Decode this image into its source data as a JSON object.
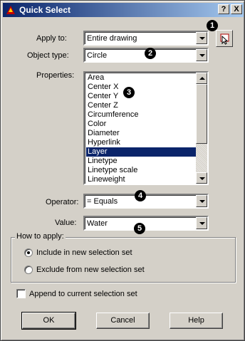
{
  "window": {
    "title": "Quick Select",
    "help_btn": "?",
    "close_btn": "X"
  },
  "form": {
    "apply_to": {
      "label": "Apply to:",
      "value": "Entire drawing"
    },
    "object_type": {
      "label": "Object type:",
      "value": "Circle"
    },
    "properties": {
      "label": "Properties:",
      "items": [
        "Area",
        "Center X",
        "Center Y",
        "Center Z",
        "Circumference",
        "Color",
        "Diameter",
        "Hyperlink",
        "Layer",
        "Linetype",
        "Linetype scale",
        "Lineweight"
      ],
      "selected": "Layer"
    },
    "operator": {
      "label": "Operator:",
      "value": "= Equals"
    },
    "value": {
      "label": "Value:",
      "value": "Water"
    }
  },
  "how_to_apply": {
    "title": "How to apply:",
    "include": "Include in new selection set",
    "exclude": "Exclude from new selection set",
    "selected": "include"
  },
  "append": {
    "label": "Append to current selection set",
    "checked": false
  },
  "buttons": {
    "ok": "OK",
    "cancel": "Cancel",
    "help": "Help"
  },
  "callouts": [
    "1",
    "2",
    "3",
    "4",
    "5"
  ],
  "colors": {
    "title_start": "#0a246a",
    "title_end": "#a6caf0",
    "selection": "#0a246a"
  }
}
